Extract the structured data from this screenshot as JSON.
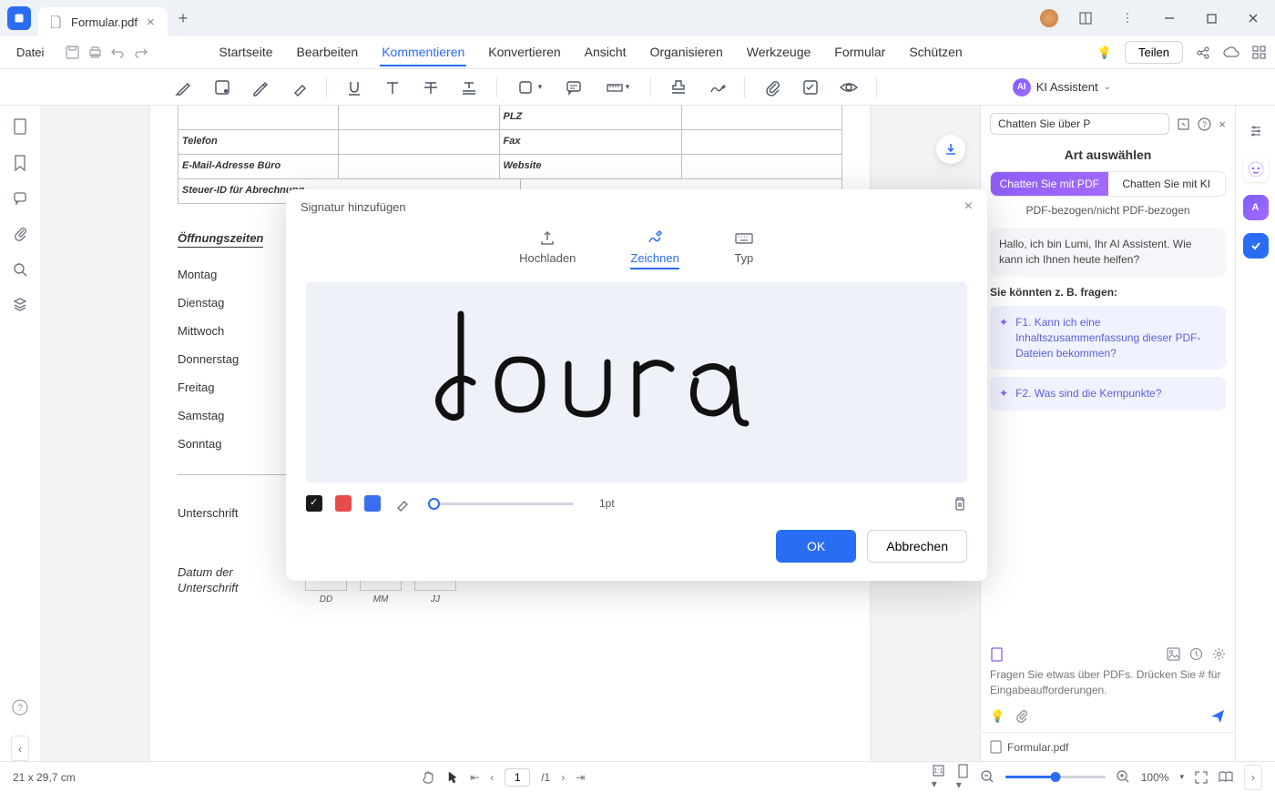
{
  "titlebar": {
    "tab_name": "Formular.pdf"
  },
  "menubar": {
    "file": "Datei",
    "items": [
      "Startseite",
      "Bearbeiten",
      "Kommentieren",
      "Konvertieren",
      "Ansicht",
      "Organisieren",
      "Werkzeuge",
      "Formular",
      "Schützen"
    ],
    "active_index": 2,
    "share": "Teilen"
  },
  "toolbar": {
    "ai_label": "KI Assistent"
  },
  "document": {
    "form_rows": [
      {
        "label1": "",
        "label2": "PLZ"
      },
      {
        "label1": "Telefon",
        "label2": "Fax"
      },
      {
        "label1": "E-Mail-Adresse Büro",
        "label2": "Website"
      },
      {
        "label1": "Steuer-ID für Abrechnung",
        "label2": ""
      }
    ],
    "section_title": "Öffnungszeiten",
    "days": [
      "Montag",
      "Dienstag",
      "Mittwoch",
      "Donnerstag",
      "Freitag",
      "Samstag",
      "Sonntag"
    ],
    "signature_label": "Unterschrift",
    "date_label": "Datum der Unterschrift",
    "date_parts": [
      "DD",
      "MM",
      "JJ"
    ]
  },
  "ai": {
    "select": "Chatten Sie über P",
    "title": "Art auswählen",
    "tabs": [
      "Chatten Sie mit PDF",
      "Chatten Sie mit KI"
    ],
    "subtabs": "PDF-bezogen/nicht PDF-bezogen",
    "greeting": "Hallo, ich bin Lumi, Ihr AI Assistent. Wie kann ich Ihnen heute helfen?",
    "suggest_head": "Sie könnten z. B. fragen:",
    "suggest1": "F1. Kann ich eine Inhaltszusammenfassung dieser PDF-Dateien bekommen?",
    "suggest2": "F2. Was sind die Kernpunkte?",
    "placeholder": "Fragen Sie etwas über PDFs. Drücken Sie # für Eingabeaufforderungen.",
    "file": "Formular.pdf"
  },
  "modal": {
    "title": "Signatur hinzufügen",
    "tabs": [
      "Hochladen",
      "Zeichnen",
      "Typ"
    ],
    "stroke": "1pt",
    "ok": "OK",
    "cancel": "Abbrechen"
  },
  "statusbar": {
    "dimensions": "21 x 29,7 cm",
    "page_current": "1",
    "page_total": "/1",
    "zoom": "100%"
  }
}
